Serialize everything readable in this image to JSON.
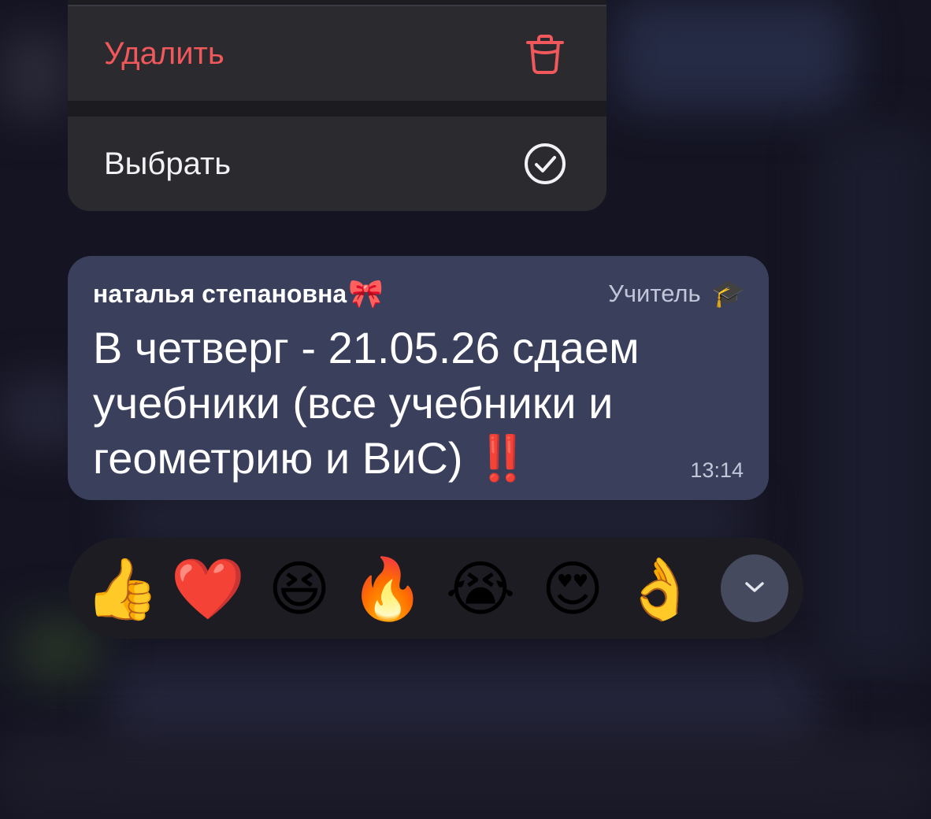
{
  "menu": {
    "items": [
      {
        "label": "Удалить",
        "icon": "trash-icon",
        "color": "#f0585b"
      },
      {
        "label": "Выбрать",
        "icon": "check-circle-icon",
        "color": "#f2f2f4"
      }
    ]
  },
  "message": {
    "sender": "наталья степановна",
    "sender_emoji": "🎀",
    "role": "Учитель",
    "role_emoji": "🎓",
    "text_lines": [
      "В четверг - 21.05.26 сдаем",
      "учебники (все учебники и",
      "геометрию и ВиС)"
    ],
    "text_emoji": "‼️",
    "time": "13:14"
  },
  "reactions": {
    "items": [
      {
        "emoji": "👍",
        "name": "thumbs-up"
      },
      {
        "emoji": "❤️",
        "name": "heart"
      },
      {
        "emoji": "😆",
        "name": "laughing"
      },
      {
        "emoji": "🔥",
        "name": "fire"
      },
      {
        "emoji": "😭",
        "name": "crying"
      },
      {
        "emoji": "😍",
        "name": "heart-eyes"
      },
      {
        "emoji": "👌",
        "name": "ok-hand"
      }
    ],
    "expand_icon": "chevron-down-icon"
  }
}
